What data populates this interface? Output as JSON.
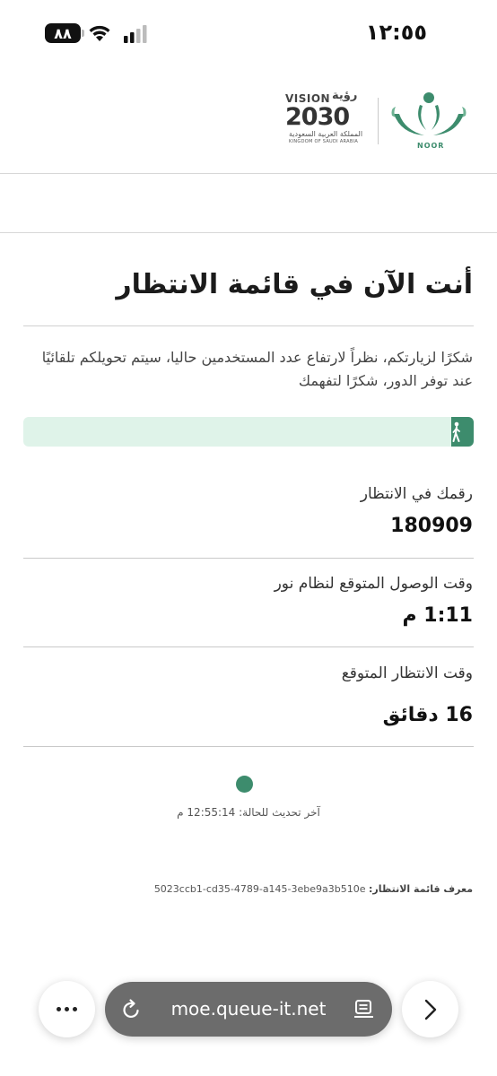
{
  "status_bar": {
    "battery": "٨٨",
    "time": "١٢:٥٥"
  },
  "header": {
    "vision_logo": {
      "word_en": "VISION",
      "word_ar": "رؤية",
      "year": "2030",
      "kingdom_ar": "المملكة العربية السعودية",
      "kingdom_en": "KINGDOM OF SAUDI ARABIA"
    },
    "noor_logo": {
      "name": "NOOR"
    }
  },
  "queue": {
    "title": "أنت الآن في قائمة الانتظار",
    "message": "شكرًا لزيارتكم، نظراً لارتفاع عدد المستخدمين حاليا، سيتم تحويلكم تلقائيًا عند توفر الدور، شكرًا لتفهمك",
    "progress": 0.05,
    "position_label": "رقمك في الانتظار",
    "position_value": "180909",
    "arrival_label": "وقت الوصول المتوقع لنظام نور",
    "arrival_value": "1:11 م",
    "wait_label": "وقت الانتظار المتوقع",
    "wait_value": "16 دقائق",
    "last_update": "آخر تحديث للحالة: 12:55:14 م",
    "queue_id_label": "معرف قائمة الانتظار:",
    "queue_id_value": "5023ccb1-cd35-4789-a145-3ebe9a3b510e"
  },
  "browser": {
    "url": "moe.queue-it.net"
  },
  "colors": {
    "accent": "#3d8c6d",
    "progress_track": "#dff3e9",
    "url_pill": "#6c6c6c"
  }
}
